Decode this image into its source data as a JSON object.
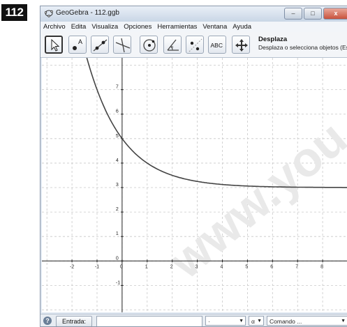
{
  "badge": "112",
  "window": {
    "title": "GeoGebra - 112.ggb",
    "controls": {
      "minimize": "–",
      "maximize": "□",
      "close": "x"
    }
  },
  "menu": [
    "Archivo",
    "Edita",
    "Visualiza",
    "Opciones",
    "Herramientas",
    "Ventana",
    "Ayuda"
  ],
  "toolbar": {
    "tools": [
      {
        "name": "move-tool",
        "icon": "arrow-cursor-icon"
      },
      {
        "name": "point-tool",
        "icon": "point-icon",
        "label": "A"
      },
      {
        "name": "line-tool",
        "icon": "line-icon"
      },
      {
        "name": "perpendicular-tool",
        "icon": "perpendicular-icon"
      },
      {
        "name": "circle-tool",
        "icon": "circle-icon"
      },
      {
        "name": "angle-tool",
        "icon": "angle-icon"
      },
      {
        "name": "reflect-tool",
        "icon": "reflect-icon"
      },
      {
        "name": "text-tool",
        "icon": "text-icon",
        "label": "ABC"
      },
      {
        "name": "move-view-tool",
        "icon": "move-view-icon"
      }
    ],
    "selected_tool_title": "Desplaza",
    "selected_tool_desc": "Desplaza o selecciona objetos (Esc)"
  },
  "graphics": {
    "x_ticks": [
      "-2",
      "-1",
      "0",
      "1",
      "2",
      "3",
      "4",
      "5",
      "6",
      "7",
      "8"
    ],
    "y_ticks_pos": [
      "7",
      "6",
      "5",
      "4",
      "3",
      "2",
      "1",
      "0"
    ],
    "y_ticks_neg": [
      "-1"
    ],
    "x_range": [
      -3.2,
      9
    ],
    "y_range": [
      -2.1,
      8.3
    ],
    "grid": true,
    "curve": {
      "function": "f(x) = 3 + 2^(-x+1)",
      "color": "#444444"
    }
  },
  "watermark": "www.you",
  "inputbar": {
    "help": "?",
    "entrada_label": "Entrada:",
    "input_value": "",
    "symbol_combo": "·",
    "greek_combo": "α",
    "command_combo": "Comando ..."
  }
}
